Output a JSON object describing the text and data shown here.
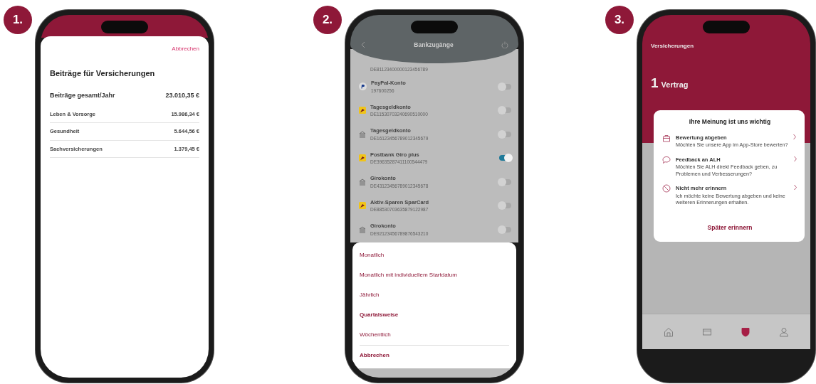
{
  "panels": [
    {
      "badge": "1.",
      "kind": "contributions",
      "cancel": "Abbrechen",
      "title": "Beiträge für Versicherungen",
      "total": {
        "label": "Beiträge gesamt/Jahr",
        "amount": "23.010,35 €"
      },
      "rows": [
        {
          "label": "Leben & Vorsorge",
          "amount": "15.986,34 €"
        },
        {
          "label": "Gesundheit",
          "amount": "5.644,56 €"
        },
        {
          "label": "Sachversicherungen",
          "amount": "1.379,45 €"
        }
      ]
    },
    {
      "badge": "2.",
      "kind": "bank_accounts",
      "title": "Bankzugänge",
      "partial_iban": "DE81123400000123456789",
      "accounts": [
        {
          "name": "PayPal-Konto",
          "number": "197600256",
          "kind": "paypal",
          "on": false
        },
        {
          "name": "Tagesgeldkonto",
          "number": "DE11530703240690510000",
          "kind": "postbank",
          "on": false
        },
        {
          "name": "Tagesgeldkonto",
          "number": "DE16123456789012345679",
          "kind": "bank",
          "on": false
        },
        {
          "name": "Postbank Giro plus",
          "number": "DE39635287411100544479",
          "kind": "postbank",
          "on": true
        },
        {
          "name": "Girokonto",
          "number": "DE43123456789012345678",
          "kind": "bank",
          "on": false
        },
        {
          "name": "Aktiv-Sparen SparCard",
          "number": "DE88530703635879122987",
          "kind": "postbank",
          "on": false
        },
        {
          "name": "Girokonto",
          "number": "DE92123456789876543210",
          "kind": "bank",
          "on": false
        }
      ],
      "sheet": [
        {
          "label": "Monatlich",
          "selected": false
        },
        {
          "label": "Monatlich mit individuellem Startdatum",
          "selected": false
        },
        {
          "label": "Jährlich",
          "selected": false
        },
        {
          "label": "Quartalsweise",
          "selected": true
        },
        {
          "label": "Wöchentlich",
          "selected": false
        }
      ],
      "sheet_cancel": "Abbrechen"
    },
    {
      "badge": "3.",
      "kind": "feedback",
      "header": "Versicherungen",
      "count": "1",
      "count_label": "Vertrag",
      "dialog": {
        "title": "Ihre Meinung ist uns wichtig",
        "options": [
          {
            "kind": "rate",
            "title": "Bewertung abgeben",
            "text": "Möchten Sie unsere App im App-Store bewerten?"
          },
          {
            "kind": "feedback",
            "title": "Feedback an ALH",
            "text": "Möchten Sie ALH direkt Feedback geben, zu Problemen und Verbesserungen?"
          },
          {
            "kind": "never",
            "title": "Nicht mehr erinnern",
            "text": "Ich möchte keine Bewertung abgeben und keine weiteren Erinnerungen erhalten."
          }
        ],
        "action": "Später erinnern"
      },
      "tabs": [
        {
          "kind": "home",
          "selected": false
        },
        {
          "kind": "card",
          "selected": false
        },
        {
          "kind": "shield",
          "selected": true
        },
        {
          "kind": "person",
          "selected": false
        }
      ]
    }
  ]
}
